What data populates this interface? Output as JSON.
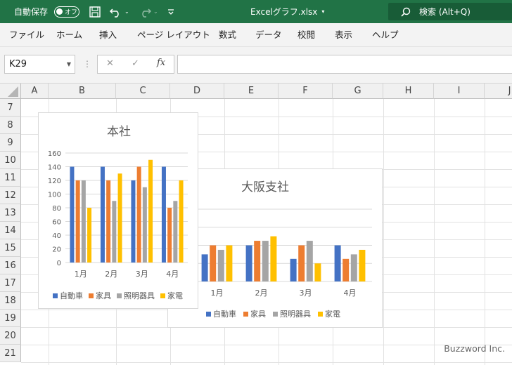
{
  "titlebar": {
    "autosave_label": "自動保存",
    "autosave_state": "オフ",
    "filename": "Excelグラフ.xlsx",
    "search_label": "検索 (Alt+Q)"
  },
  "ribbon": {
    "tabs": [
      "ファイル",
      "ホーム",
      "挿入",
      "ページ レイアウト",
      "数式",
      "データ",
      "校閲",
      "表示",
      "ヘルプ"
    ]
  },
  "formula_bar": {
    "name_box": "K29",
    "cancel_glyph": "✕",
    "enter_glyph": "✓",
    "fx_glyph": "fx",
    "value": ""
  },
  "sheet": {
    "columns": [
      "A",
      "B",
      "C",
      "D",
      "E",
      "F",
      "G",
      "H",
      "I",
      "J"
    ],
    "rows": [
      "7",
      "8",
      "9",
      "10",
      "11",
      "12",
      "13",
      "14",
      "15",
      "16",
      "17",
      "18",
      "19",
      "20",
      "21"
    ]
  },
  "watermark": "Buzzword Inc.",
  "colors": {
    "excel_green": "#217346",
    "series": [
      "#4472c4",
      "#ed7d31",
      "#a5a5a5",
      "#ffc000"
    ]
  },
  "chart_data": [
    {
      "type": "bar",
      "title": "本社",
      "categories": [
        "1月",
        "2月",
        "3月",
        "4月"
      ],
      "ylim": [
        0,
        160
      ],
      "yticks": [
        "0",
        "20",
        "40",
        "60",
        "80",
        "100",
        "120",
        "140",
        "160"
      ],
      "grid": true,
      "legend_position": "bottom",
      "series": [
        {
          "name": "自動車",
          "values": [
            140,
            140,
            120,
            140
          ]
        },
        {
          "name": "家具",
          "values": [
            120,
            120,
            140,
            80
          ]
        },
        {
          "name": "照明器具",
          "values": [
            120,
            90,
            110,
            90
          ]
        },
        {
          "name": "家電",
          "values": [
            80,
            130,
            150,
            120
          ]
        }
      ]
    },
    {
      "type": "bar",
      "title": "大阪支社",
      "categories": [
        "1月",
        "2月",
        "3月",
        "4月"
      ],
      "ylim": [
        0,
        80
      ],
      "grid": true,
      "legend_position": "bottom",
      "series": [
        {
          "name": "自動車",
          "values": [
            30,
            40,
            25,
            40
          ]
        },
        {
          "name": "家具",
          "values": [
            40,
            45,
            40,
            25
          ]
        },
        {
          "name": "照明器具",
          "values": [
            35,
            45,
            45,
            30
          ]
        },
        {
          "name": "家電",
          "values": [
            40,
            50,
            20,
            35
          ]
        }
      ]
    }
  ]
}
